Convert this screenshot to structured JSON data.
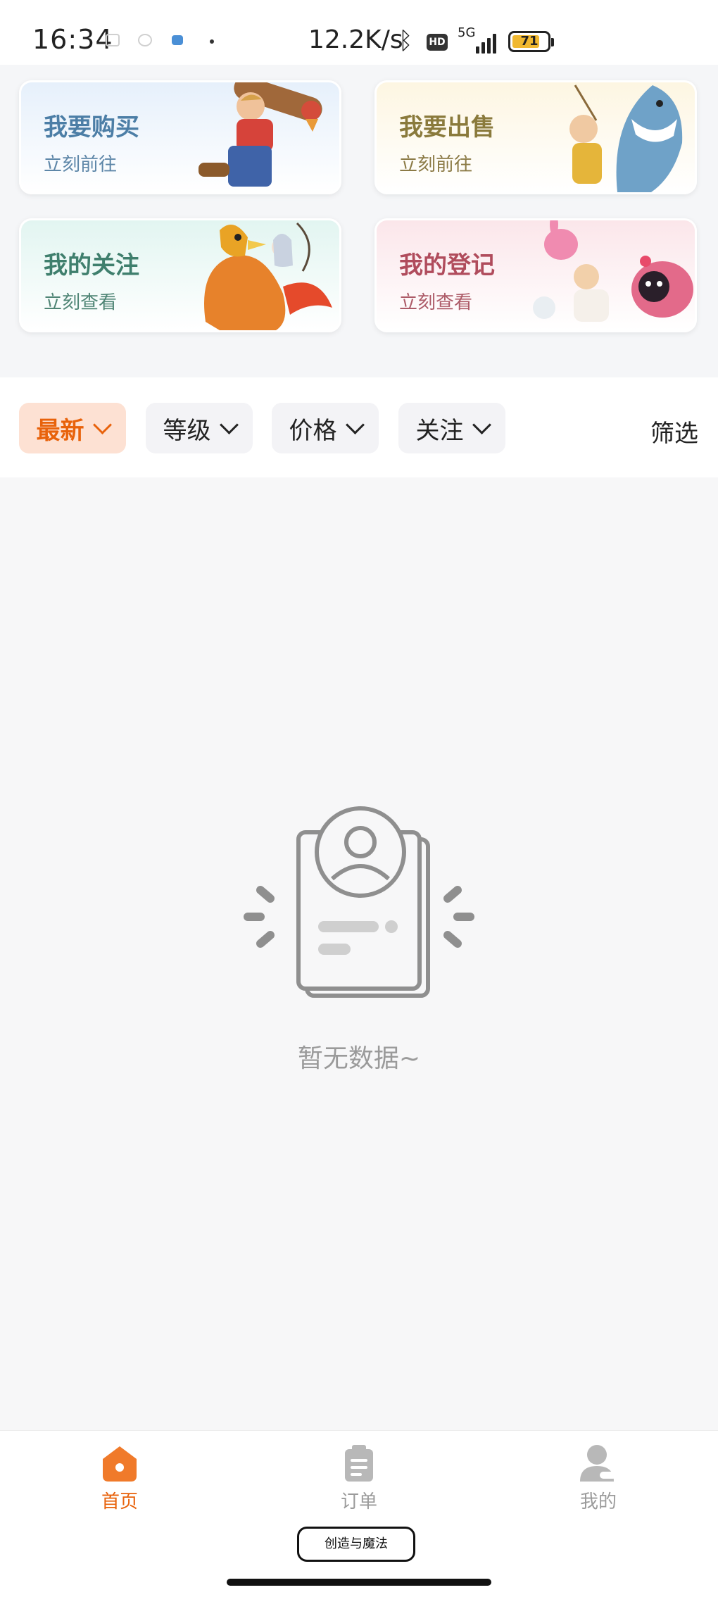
{
  "status_bar": {
    "time": "16:34",
    "net_speed": "12.2K/s",
    "network": "5G",
    "hd_badge": "HD",
    "battery": "71"
  },
  "cards": [
    {
      "title": "我要购买",
      "subtitle": "立刻前往"
    },
    {
      "title": "我要出售",
      "subtitle": "立刻前往"
    },
    {
      "title": "我的关注",
      "subtitle": "立刻查看"
    },
    {
      "title": "我的登记",
      "subtitle": "立刻查看"
    }
  ],
  "filters": {
    "chips": [
      "最新",
      "等级",
      "价格",
      "关注"
    ],
    "active": "最新",
    "filter_label": "筛选"
  },
  "empty_state": {
    "message": "暂无数据~"
  },
  "bottom_nav": {
    "tabs": [
      "首页",
      "订单",
      "我的"
    ],
    "active": "首页",
    "center_button": "创造与魔法"
  },
  "colors": {
    "accent": "#e8620b",
    "active_chip_bg": "#fde1d3",
    "inactive_tab": "#9b9b9b"
  }
}
